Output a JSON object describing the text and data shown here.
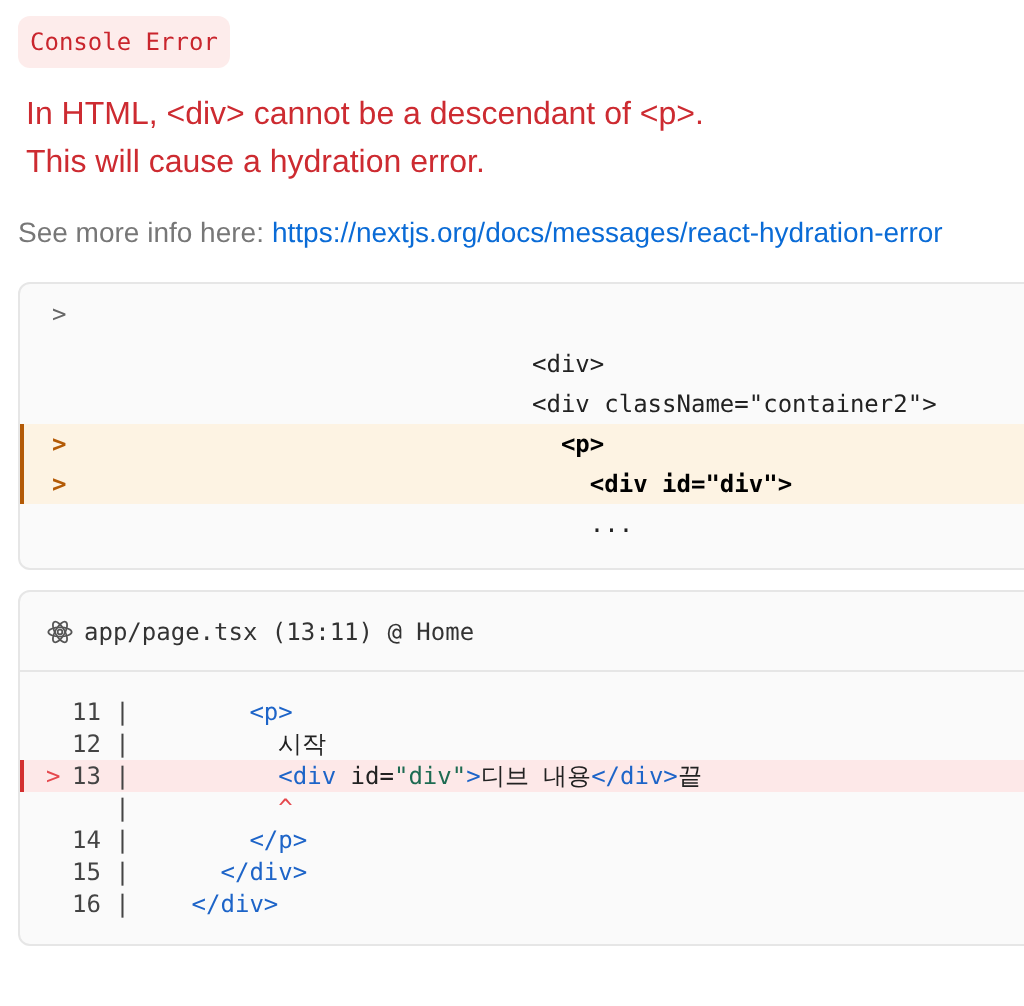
{
  "badge": "Console Error",
  "message": [
    "In HTML, <div> cannot be a descendant of <p>.",
    "This will cause a hydration error."
  ],
  "info": {
    "label": "See more info here:",
    "link": "https://nextjs.org/docs/messages/react-hydration-error"
  },
  "diff": {
    "toggle": ">",
    "lines": [
      {
        "text": "<div>",
        "highlighted": false
      },
      {
        "text": "<div className=\"container2\">",
        "highlighted": false
      },
      {
        "pointer": ">",
        "text": "  <p>",
        "highlighted": true
      },
      {
        "pointer": ">",
        "text": "    <div id=\"div\">",
        "highlighted": true
      },
      {
        "text": "    ...",
        "highlighted": false
      }
    ]
  },
  "source": {
    "file": "app/page.tsx (13:11) @ Home",
    "lines": [
      {
        "gutter": "11 |",
        "error": false,
        "segments": [
          {
            "kind": "tag",
            "text": "        <p>"
          }
        ]
      },
      {
        "gutter": "12 |",
        "error": false,
        "segments": [
          {
            "kind": "text",
            "text": "          시작"
          }
        ]
      },
      {
        "pointer": ">",
        "gutter": "13 |",
        "error": true,
        "segments": [
          {
            "kind": "tag",
            "text": "          <div"
          },
          {
            "kind": "text",
            "text": " id="
          },
          {
            "kind": "string",
            "text": "\"div\""
          },
          {
            "kind": "tag",
            "text": ">"
          },
          {
            "kind": "text",
            "text": "디브 내용"
          },
          {
            "kind": "tag",
            "text": "</div>"
          },
          {
            "kind": "text",
            "text": "끝"
          }
        ]
      },
      {
        "gutter": "   |",
        "error": false,
        "segments": [
          {
            "kind": "caret",
            "text": "          ^"
          }
        ]
      },
      {
        "gutter": "14 |",
        "error": false,
        "segments": [
          {
            "kind": "tag",
            "text": "        </p>"
          }
        ]
      },
      {
        "gutter": "15 |",
        "error": false,
        "segments": [
          {
            "kind": "tag",
            "text": "      </div>"
          }
        ]
      },
      {
        "gutter": "16 |",
        "error": false,
        "segments": [
          {
            "kind": "tag",
            "text": "    </div>"
          }
        ]
      }
    ]
  }
}
